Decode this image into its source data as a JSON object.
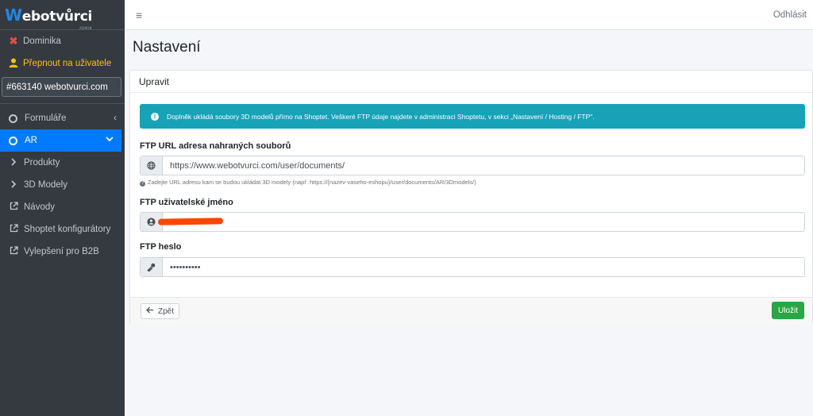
{
  "brand": {
    "logo_w": "W",
    "logo_rest": "ebotvůrci",
    "logo_sub": "ADMIN"
  },
  "user": {
    "name": "Dominika",
    "switch_label": "Přepnout na uživatele",
    "shop": "#663140 webotvurci.com"
  },
  "sidebar": {
    "items": [
      {
        "label": "Formuláře"
      },
      {
        "label": "AR"
      },
      {
        "label": "Produkty"
      },
      {
        "label": "3D Modely"
      },
      {
        "label": "Návody"
      },
      {
        "label": "Shoptet konfigurátory"
      },
      {
        "label": "Vylepšení pro B2B"
      }
    ]
  },
  "topbar": {
    "menu_icon": "≡",
    "logout": "Odhlásit"
  },
  "page": {
    "title": "Nastavení"
  },
  "card": {
    "header": "Upravit",
    "alert": "Doplněk ukládá soubory 3D modelů přímo na Shoptet. Veškeré FTP údaje najdete v administraci Shoptetu, v sekci „Nastavení / Hosting / FTP\".",
    "ftp_url": {
      "label": "FTP URL adresa nahraných souborů",
      "value": "https://www.webotvurci.com/user/documents/",
      "hint": "Zadejte URL adresu kam se budou ukládat 3D modely (např. https://{nazev-vaseho-eshopu}/user/documents/AR/3Dmodels/)"
    },
    "ftp_user": {
      "label": "FTP uživatelské jméno",
      "value": ""
    },
    "ftp_pass": {
      "label": "FTP heslo",
      "value": "••••••••••"
    },
    "back_label": "Zpět",
    "save_label": "Uložit"
  },
  "colors": {
    "sidebar": "#343a40",
    "active": "#007bff",
    "alert": "#17a2b8",
    "save": "#28a745",
    "redaction": "#ff4500"
  }
}
